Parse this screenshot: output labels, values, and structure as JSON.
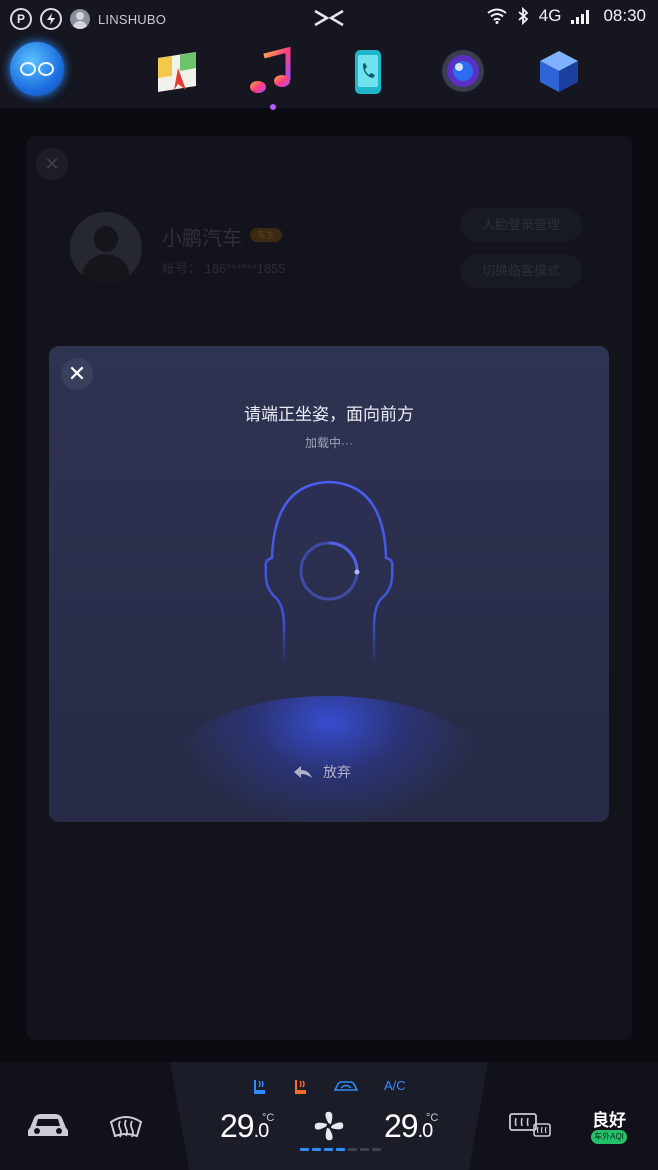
{
  "status_bar": {
    "parking_icon": "P",
    "username": "LINSHUBO",
    "network": "4G",
    "time": "08:30"
  },
  "dock": {
    "apps": [
      "assistant",
      "maps",
      "music",
      "phone",
      "camera",
      "app-store"
    ],
    "active_app": "music"
  },
  "background_page": {
    "name": "小鹏汽车",
    "badge": "车主",
    "account": "帐号： 186******1855",
    "face_login_button": "人脸登录管理",
    "guest_mode_button": "切换临客模式"
  },
  "modal": {
    "close_icon": "✕",
    "title": "请端正坐姿，面向前方",
    "subtitle": "加载中···",
    "give_up_label": "放弃"
  },
  "climate": {
    "ac_label": "A/C",
    "left_temp_int": "29",
    "left_temp_dec": ".0",
    "right_temp_int": "29",
    "right_temp_dec": ".0",
    "unit": "°C",
    "fan_level": 4,
    "fan_max": 7,
    "air_quality": "良好",
    "air_quality_sub": "车外AQI"
  },
  "colors": {
    "accent_blue": "#2e8cff",
    "modal_bg": "#2c3050",
    "aqi_green": "#25c06a"
  }
}
